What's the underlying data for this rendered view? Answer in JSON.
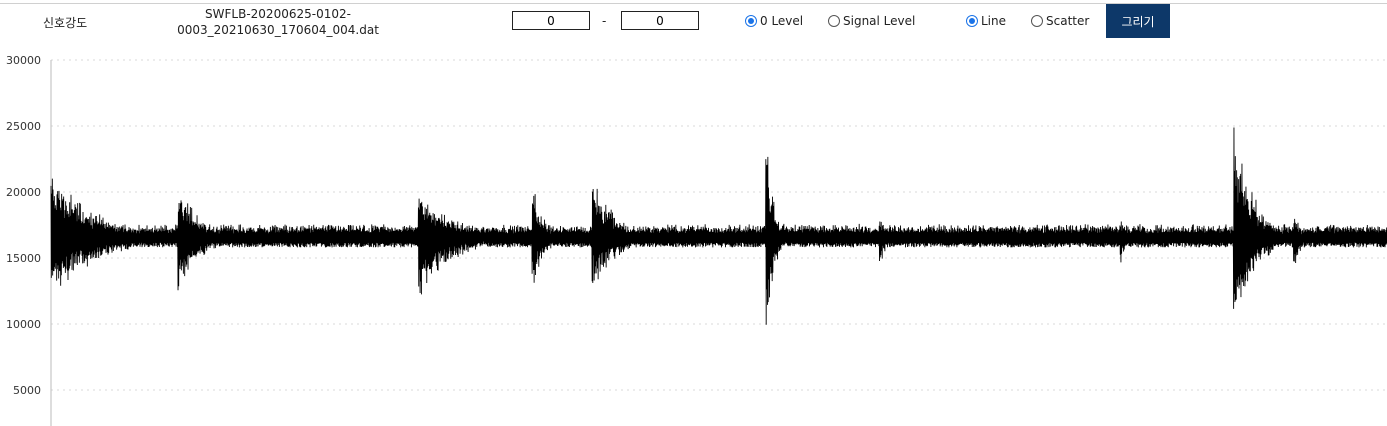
{
  "header": {
    "title": "신호강도",
    "filename_line1": "SWFLB-20200625-0102-",
    "filename_line2": "0003_20210630_170604_004.dat",
    "range_from": "0",
    "range_to": "0",
    "range_separator": "-",
    "level_options": [
      {
        "label": "0 Level",
        "checked": true
      },
      {
        "label": "Signal Level",
        "checked": false
      }
    ],
    "style_options": [
      {
        "label": "Line",
        "checked": true
      },
      {
        "label": "Scatter",
        "checked": false
      }
    ],
    "draw_button": "그리기"
  },
  "colors": {
    "line": "#000000",
    "button_bg": "#0d3869",
    "radio_checked": "#1a73e8",
    "grid": "#d9d9d9"
  },
  "chart_data": {
    "type": "line",
    "title": "",
    "xlabel": "",
    "ylabel": "",
    "ylim": [
      0,
      30000
    ],
    "yticks": [
      5000,
      10000,
      15000,
      20000,
      25000,
      30000
    ],
    "grid": true,
    "baseline": 16500,
    "bursts": [
      {
        "x_start": 0.0,
        "x_end": 0.18,
        "max": 22000,
        "min": 11700
      },
      {
        "x_start": 0.095,
        "x_end": 0.18,
        "max": 21200,
        "min": 12100
      },
      {
        "x_start": 0.275,
        "x_end": 0.4,
        "max": 21000,
        "min": 11300
      },
      {
        "x_start": 0.36,
        "x_end": 0.4,
        "max": 21400,
        "min": 11900
      },
      {
        "x_start": 0.405,
        "x_end": 0.5,
        "max": 21500,
        "min": 12300
      },
      {
        "x_start": 0.535,
        "x_end": 0.565,
        "max": 24900,
        "min": 7600
      },
      {
        "x_start": 0.62,
        "x_end": 0.64,
        "max": 19000,
        "min": 13300
      },
      {
        "x_start": 0.8,
        "x_end": 0.82,
        "max": 18800,
        "min": 13800
      },
      {
        "x_start": 0.885,
        "x_end": 0.96,
        "max": 25900,
        "min": 8300
      },
      {
        "x_start": 0.93,
        "x_end": 0.96,
        "max": 18700,
        "min": 13800
      },
      {
        "x_start": 0.975,
        "x_end": 1.0,
        "max": 17900,
        "min": 15400
      }
    ]
  }
}
